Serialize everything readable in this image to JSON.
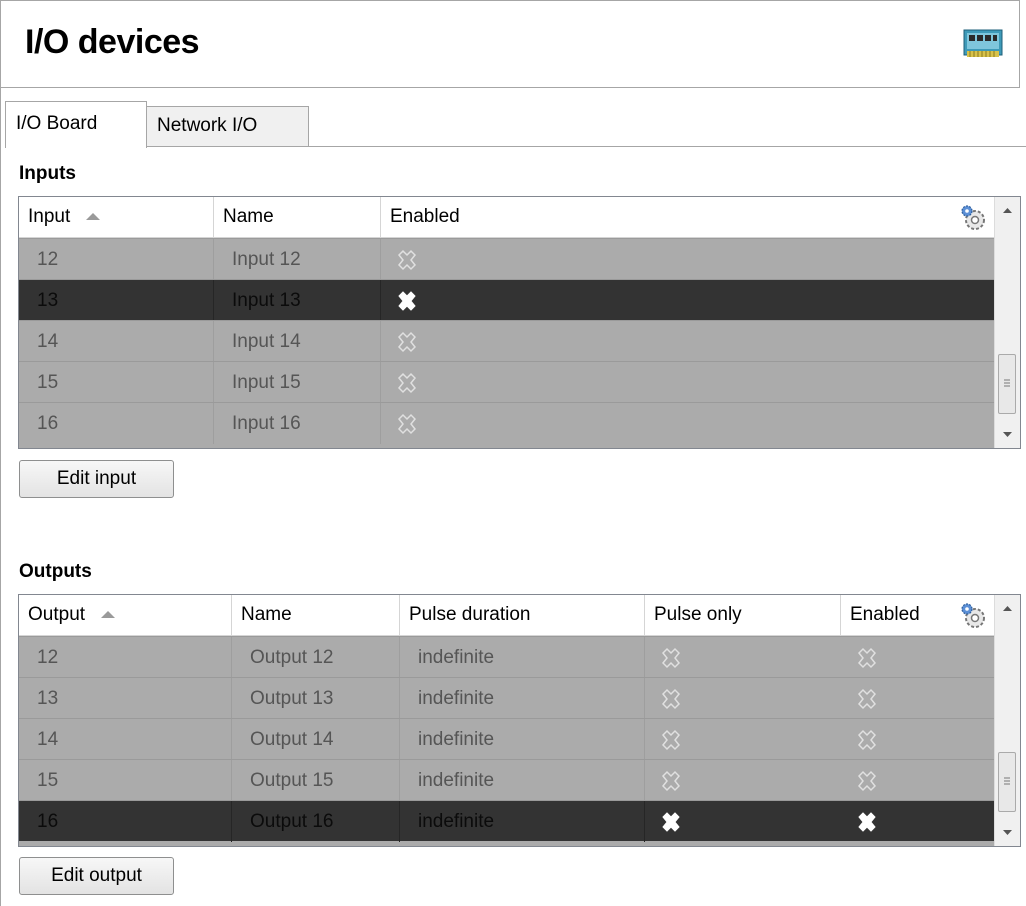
{
  "header": {
    "title": "I/O devices"
  },
  "tabs": [
    {
      "label": "I/O Board"
    },
    {
      "label": "Network I/O"
    }
  ],
  "inputs": {
    "section_label": "Inputs",
    "columns": [
      "Input",
      "Name",
      "Enabled"
    ],
    "rows": [
      {
        "input": "12",
        "name": "Input 12",
        "enabled": false,
        "selected": false
      },
      {
        "input": "13",
        "name": "Input 13",
        "enabled": false,
        "selected": true
      },
      {
        "input": "14",
        "name": "Input 14",
        "enabled": false,
        "selected": false
      },
      {
        "input": "15",
        "name": "Input 15",
        "enabled": false,
        "selected": false
      },
      {
        "input": "16",
        "name": "Input 16",
        "enabled": false,
        "selected": false
      }
    ],
    "edit_label": "Edit input"
  },
  "outputs": {
    "section_label": "Outputs",
    "columns": [
      "Output",
      "Name",
      "Pulse duration",
      "Pulse only",
      "Enabled"
    ],
    "rows": [
      {
        "output": "12",
        "name": "Output 12",
        "pulse_duration": "indefinite",
        "pulse_only": false,
        "enabled": false,
        "selected": false
      },
      {
        "output": "13",
        "name": "Output 13",
        "pulse_duration": "indefinite",
        "pulse_only": false,
        "enabled": false,
        "selected": false
      },
      {
        "output": "14",
        "name": "Output 14",
        "pulse_duration": "indefinite",
        "pulse_only": false,
        "enabled": false,
        "selected": false
      },
      {
        "output": "15",
        "name": "Output 15",
        "pulse_duration": "indefinite",
        "pulse_only": false,
        "enabled": false,
        "selected": false
      },
      {
        "output": "16",
        "name": "Output 16",
        "pulse_duration": "indefinite",
        "pulse_only": false,
        "enabled": false,
        "selected": true
      }
    ],
    "edit_label": "Edit output"
  },
  "colors": {
    "row_bg": "#ababab",
    "selected_row_bg": "#333333",
    "cell_text": "#555555"
  }
}
